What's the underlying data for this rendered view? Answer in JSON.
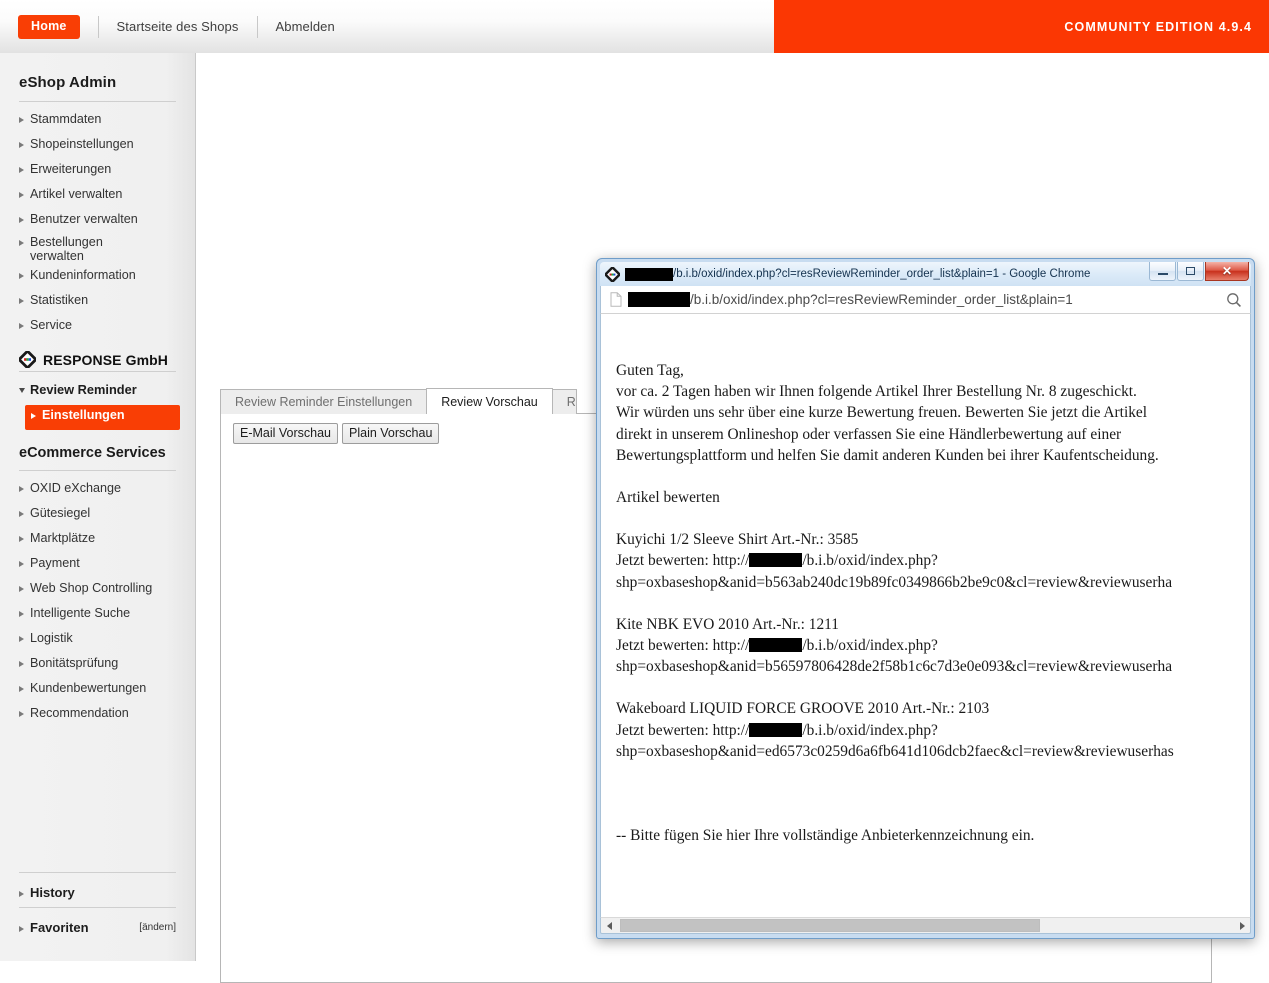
{
  "topbar": {
    "home_label": "Home",
    "shop_home_label": "Startseite des Shops",
    "logout_label": "Abmelden",
    "edition_label": "COMMUNITY EDITION 4.9.4",
    "accent_color": "#fb3703"
  },
  "sidebar": {
    "title": "eShop Admin",
    "items": [
      {
        "label": "Stammdaten"
      },
      {
        "label": "Shopeinstellungen"
      },
      {
        "label": "Erweiterungen"
      },
      {
        "label": "Artikel verwalten"
      },
      {
        "label": "Benutzer verwalten"
      },
      {
        "label": "Bestellungen verwalten"
      },
      {
        "label": "Kundeninformation"
      },
      {
        "label": "Statistiken"
      },
      {
        "label": "Service"
      }
    ],
    "brand": "RESPONSE GmbH",
    "module_group": "Review Reminder",
    "module_active_item": "Einstellungen",
    "services_title": "eCommerce Services",
    "services": [
      {
        "label": "OXID eXchange"
      },
      {
        "label": "Gütesiegel"
      },
      {
        "label": "Marktplätze"
      },
      {
        "label": "Payment"
      },
      {
        "label": "Web Shop Controlling"
      },
      {
        "label": "Intelligente Suche"
      },
      {
        "label": "Logistik"
      },
      {
        "label": "Bonitätsprüfung"
      },
      {
        "label": "Kundenbewertungen"
      },
      {
        "label": "Recommendation"
      }
    ],
    "history_label": "History",
    "favorites_label": "Favoriten",
    "favorites_change_label": "[ändern]"
  },
  "main": {
    "tabs": [
      {
        "label": "Review Reminder Einstellungen",
        "active": false
      },
      {
        "label": "Review Vorschau",
        "active": true
      },
      {
        "label": "R",
        "active": false
      }
    ],
    "buttons": [
      {
        "label": "E-Mail Vorschau"
      },
      {
        "label": "Plain Vorschau"
      }
    ]
  },
  "browser_window": {
    "title": "/b.i.b/oxid/index.php?cl=resReviewReminder_order_list&plain=1 - Google Chrome",
    "title_redacted_prefix": "██████",
    "url": "/b.i.b/oxid/index.php?cl=resReviewReminder_order_list&plain=1",
    "url_redacted_host": "███████",
    "minimize_label": "Minimieren",
    "maximize_label": "Maximieren",
    "close_label": "Schließen",
    "zoom_icon_label": "zoom-icon",
    "scroll_left_label": "nach links scrollen",
    "scroll_right_label": "nach rechts scrollen"
  },
  "email": {
    "greeting": "Guten Tag,",
    "line1": "vor ca. 2 Tagen haben wir Ihnen folgende Artikel Ihrer Bestellung Nr. 8 zugeschickt.",
    "line2": "Wir würden uns sehr über eine kurze Bewertung freuen. Bewerten Sie jetzt die Artikel",
    "line3": "direkt in unserem Onlineshop oder verfassen Sie eine Händlerbewertung auf einer",
    "line4": "Bewertungsplattform und helfen Sie damit anderen Kunden bei ihrer Kaufentscheidung.",
    "section_heading": "Artikel bewerten",
    "items": [
      {
        "title": "Kuyichi 1/2 Sleeve Shirt Art.-Nr.: 3585",
        "rate_prefix": "Jetzt bewerten: http://",
        "rate_suffix": "/b.i.b/oxid/index.php?",
        "query": "shp=oxbaseshop&anid=b563ab240dc19b89fc0349866b2be9c0&cl=review&reviewuserha"
      },
      {
        "title": "Kite NBK EVO 2010 Art.-Nr.: 1211",
        "rate_prefix": "Jetzt bewerten: http://",
        "rate_suffix": "/b.i.b/oxid/index.php?",
        "query": "shp=oxbaseshop&anid=b56597806428de2f58b1c6c7d3e0e093&cl=review&reviewuserha"
      },
      {
        "title": "Wakeboard LIQUID FORCE GROOVE 2010 Art.-Nr.: 2103",
        "rate_prefix": "Jetzt bewerten: http://",
        "rate_suffix": "/b.i.b/oxid/index.php?",
        "query": "shp=oxbaseshop&anid=ed6573c0259d6a6fb641d106dcb2faec&cl=review&reviewuserhas"
      }
    ],
    "footer": "-- Bitte fügen Sie hier Ihre vollständige Anbieterkennzeichnung ein."
  }
}
